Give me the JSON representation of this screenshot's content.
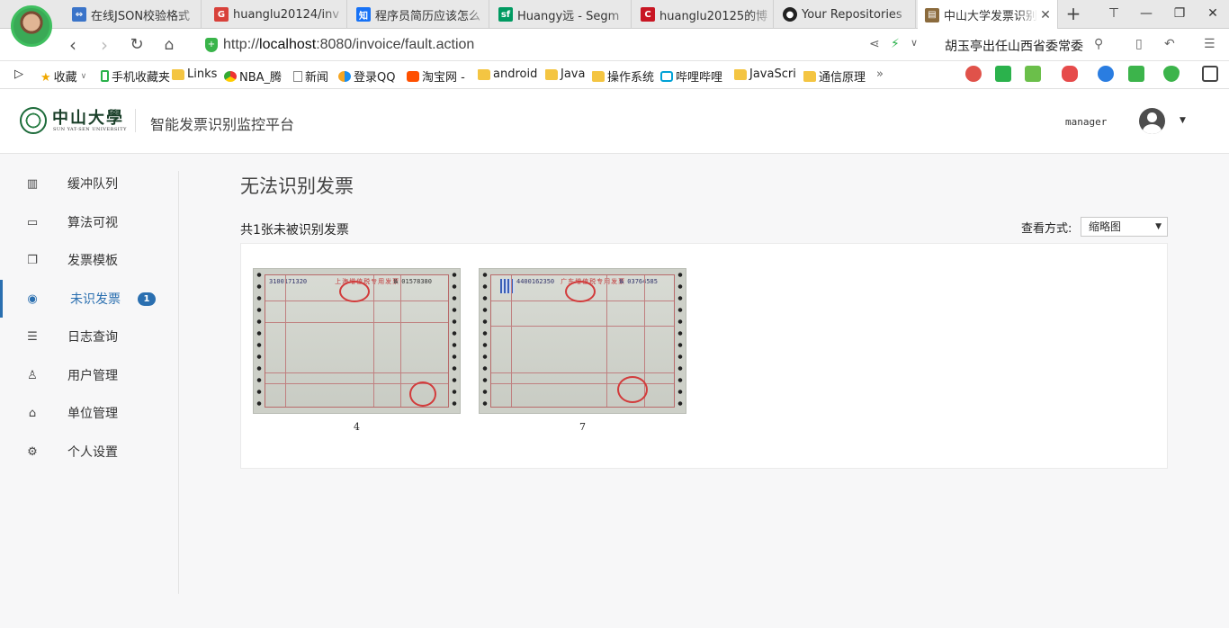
{
  "browser": {
    "tabs": [
      {
        "label": "在线JSON校验格式",
        "favicon": "code-icon",
        "color": "#3a74c9"
      },
      {
        "label": "huanglu20124/inv",
        "favicon": "g-icon",
        "color": "#d8413a"
      },
      {
        "label": "程序员简历应该怎么",
        "favicon": "zhihu-icon",
        "color": "#1772f6",
        "glyph": "知"
      },
      {
        "label": "Huangy远 - Segm",
        "favicon": "segmentfault-icon",
        "color": "#009a61",
        "glyph": "sf"
      },
      {
        "label": "huanglu20125的博",
        "favicon": "csdn-icon",
        "color": "#c81623",
        "glyph": "C"
      },
      {
        "label": "Your Repositories",
        "favicon": "github-icon",
        "color": "#222222"
      },
      {
        "label": "中山大学发票识别",
        "favicon": "page-icon",
        "color": "#8b6b3d",
        "active": true
      }
    ],
    "url_host": "localhost",
    "url_rest": ":8080/invoice/fault.action",
    "url_prefix": "http://",
    "search_text": "胡玉亭出任山西省委常委"
  },
  "bookmarks": [
    {
      "label": "收藏",
      "icon": "star-icon"
    },
    {
      "label": "手机收藏夹",
      "icon": "phone-icon"
    },
    {
      "label": "Links",
      "icon": "folder-icon"
    },
    {
      "label": "NBA_腾",
      "icon": "chrome-icon"
    },
    {
      "label": "新闻",
      "icon": "page-icon"
    },
    {
      "label": "登录QQ",
      "icon": "qq-icon"
    },
    {
      "label": "淘宝网 -",
      "icon": "taobao-icon"
    },
    {
      "label": "android",
      "icon": "folder-icon"
    },
    {
      "label": "Java",
      "icon": "folder-icon"
    },
    {
      "label": "操作系统",
      "icon": "folder-icon"
    },
    {
      "label": "哔哩哔哩",
      "icon": "bilibili-icon"
    },
    {
      "label": "JavaScri",
      "icon": "folder-icon"
    },
    {
      "label": "通信原理",
      "icon": "folder-icon"
    }
  ],
  "app": {
    "logo_text": "中山大學",
    "logo_sub": "SUN YAT-SEN UNIVERSITY",
    "title": "智能发票识别监控平台",
    "username": "manager"
  },
  "sidebar": {
    "items": [
      {
        "label": "缓冲队列",
        "icon": "bar-chart-icon"
      },
      {
        "label": "算法可视",
        "icon": "monitor-icon"
      },
      {
        "label": "发票模板",
        "icon": "copy-icon"
      },
      {
        "label": "未识发票",
        "icon": "target-icon",
        "active": true,
        "badge": "1"
      },
      {
        "label": "日志查询",
        "icon": "list-icon"
      },
      {
        "label": "用户管理",
        "icon": "user-icon"
      },
      {
        "label": "单位管理",
        "icon": "bank-icon"
      },
      {
        "label": "个人设置",
        "icon": "gear-icon"
      }
    ]
  },
  "main": {
    "title": "无法识别发票",
    "count_text": "共1张未被识别发票",
    "view_label": "查看方式:",
    "view_selected": "缩略图",
    "invoices": [
      {
        "caption": "4",
        "serial": "3100171320",
        "heading": "上海增值税专用发票",
        "number": "№ 01578380"
      },
      {
        "caption": "7",
        "serial": "4400162350",
        "heading": "广东增值税专用发票",
        "number": "№ 03764585"
      }
    ]
  },
  "colors": {
    "accent": "#2a6fb0",
    "seal_red": "#d23b3b"
  }
}
